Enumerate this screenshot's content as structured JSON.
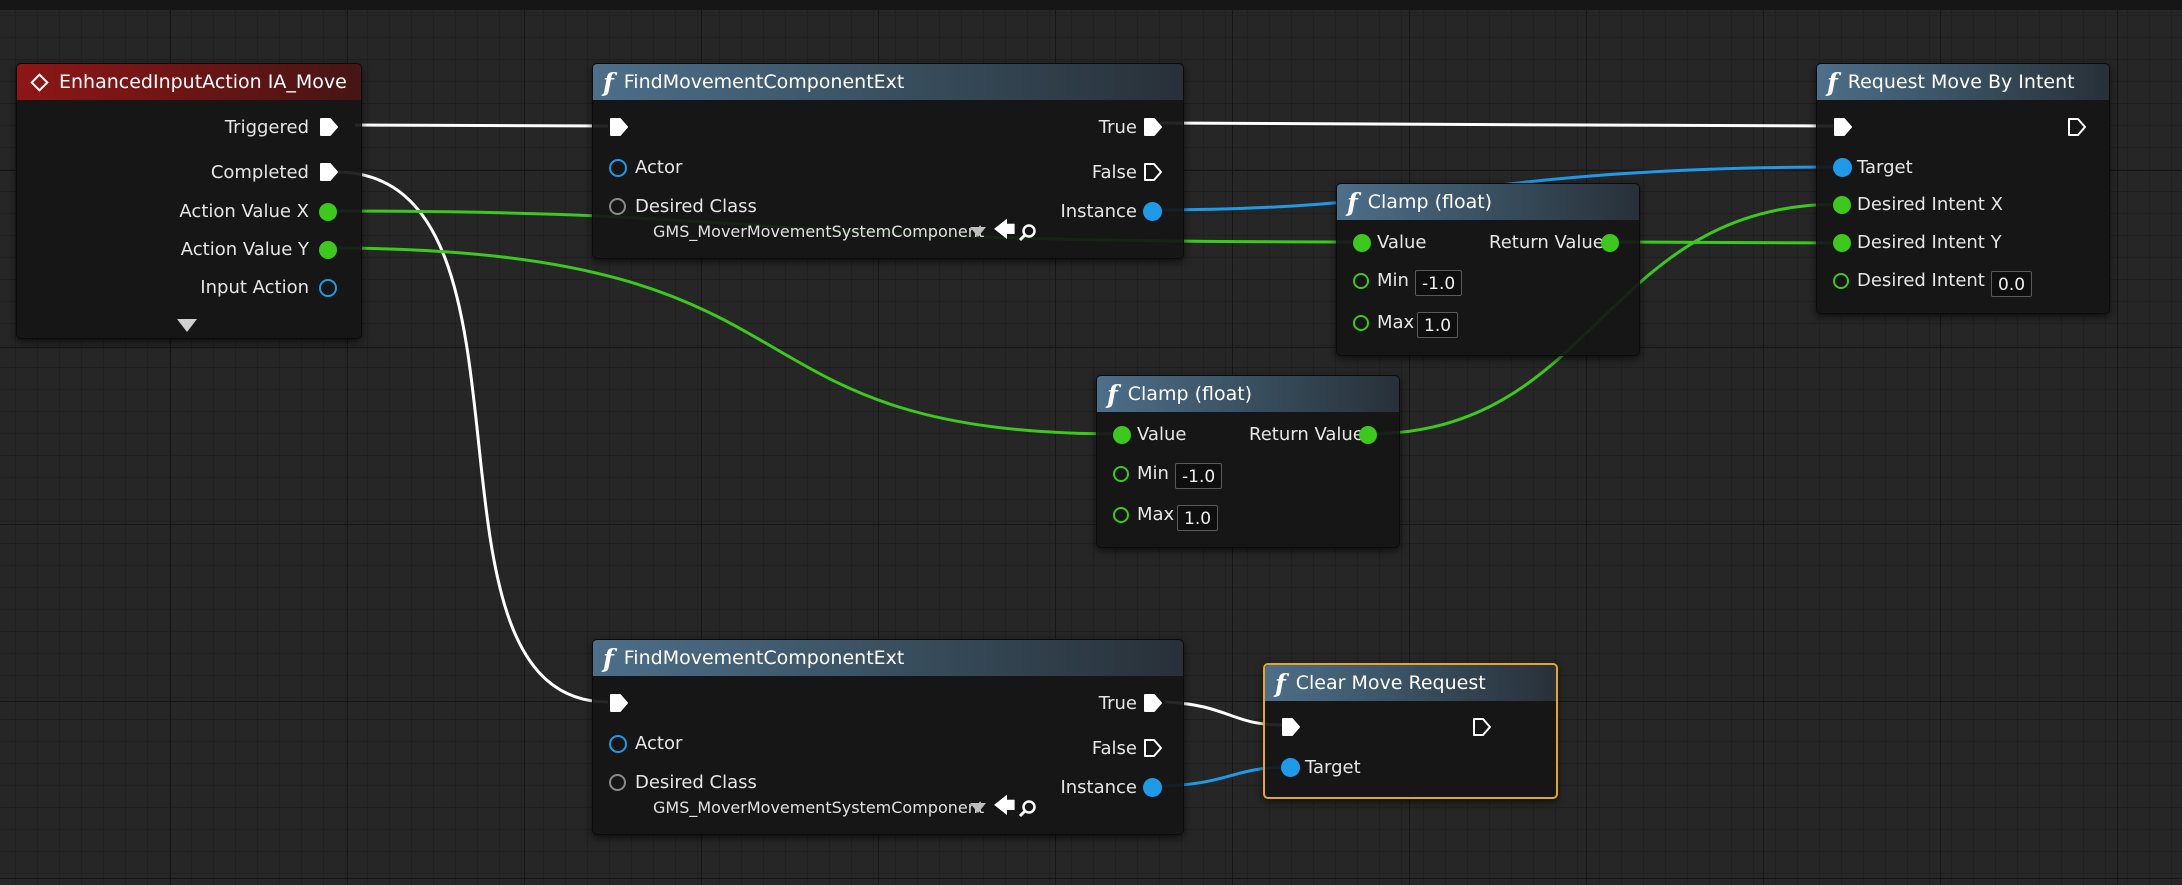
{
  "nodes": {
    "event": {
      "title": "EnhancedInputAction IA_Move",
      "pins": {
        "triggered": "Triggered",
        "completed": "Completed",
        "action_x": "Action Value X",
        "action_y": "Action Value Y",
        "input_action": "Input Action"
      }
    },
    "find_top": {
      "title": "FindMovementComponentExt",
      "pins": {
        "actor": "Actor",
        "desired_class": "Desired Class",
        "class_value": "GMS_MoverMovementSystemComponent",
        "true": "True",
        "false": "False",
        "instance": "Instance"
      }
    },
    "find_bottom": {
      "title": "FindMovementComponentExt",
      "pins": {
        "actor": "Actor",
        "desired_class": "Desired Class",
        "class_value": "GMS_MoverMovementSystemComponent",
        "true": "True",
        "false": "False",
        "instance": "Instance"
      }
    },
    "clamp1": {
      "title": "Clamp (float)",
      "pins": {
        "value": "Value",
        "return_value": "Return Value",
        "min": "Min",
        "max": "Max"
      },
      "min_value": "-1.0",
      "max_value": "1.0"
    },
    "clamp2": {
      "title": "Clamp (float)",
      "pins": {
        "value": "Value",
        "return_value": "Return Value",
        "min": "Min",
        "max": "Max"
      },
      "min_value": "-1.0",
      "max_value": "1.0"
    },
    "request": {
      "title": "Request Move By Intent",
      "pins": {
        "target": "Target",
        "intent_x": "Desired Intent X",
        "intent_y": "Desired Intent Y",
        "intent_z": "Desired Intent Z"
      },
      "intent_z_value": "0.0"
    },
    "clear": {
      "title": "Clear Move Request",
      "pins": {
        "target": "Target"
      }
    }
  },
  "colors": {
    "exec_wire": "#ffffff",
    "float_wire": "#3cc81c",
    "object_wire": "#1f9ae8",
    "event_header": "#8e1616",
    "function_header": "#4d6f8a",
    "selection_outline": "#e6a622"
  },
  "icons": {
    "function": "function-icon",
    "event": "event-diamond-icon",
    "exec": "exec-pin-icon",
    "dropdown": "chevron-down-icon",
    "use_selected": "arrow-left-icon",
    "browse": "search-icon",
    "expand": "expand-arrow-icon"
  },
  "function_glyph": "f"
}
